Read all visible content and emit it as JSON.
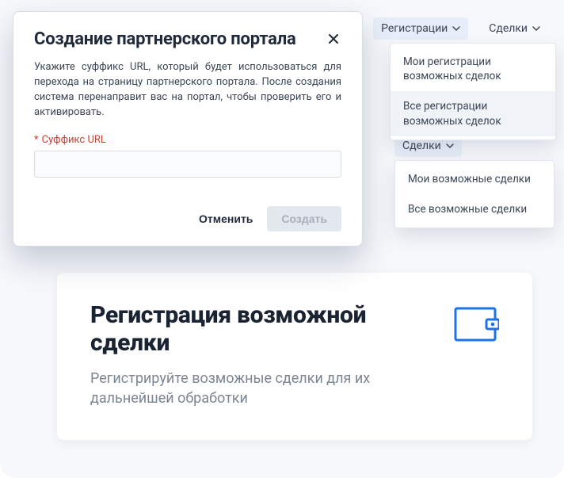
{
  "modal": {
    "title": "Создание партнерского портала",
    "description": "Укажите суффикс URL, который будет использоваться для перехода на страницу партнерского портала. После создания система перенаправит вас на портал, чтобы проверить его и активировать.",
    "field_required_mark": "*",
    "field_label": "Суффикс URL",
    "input_value": "",
    "cancel": "Отменить",
    "create": "Создать"
  },
  "top_dd": {
    "registrations_label": "Регистрации",
    "deals_label": "Сделки",
    "reg_menu": [
      "Мои регистрации возможных сделок",
      "Все регистрации возможных сделок"
    ]
  },
  "deals_dd": {
    "label": "Сделки",
    "menu": [
      "Мои возможные сделки",
      "Все возможные сделки"
    ]
  },
  "promo": {
    "title": "Регистрация возможной сделки",
    "sub": "Регистрируйте возможные сделки для их дальнейшей обработки"
  },
  "colors": {
    "accent": "#1a73e8",
    "required": "#d23c2f"
  }
}
